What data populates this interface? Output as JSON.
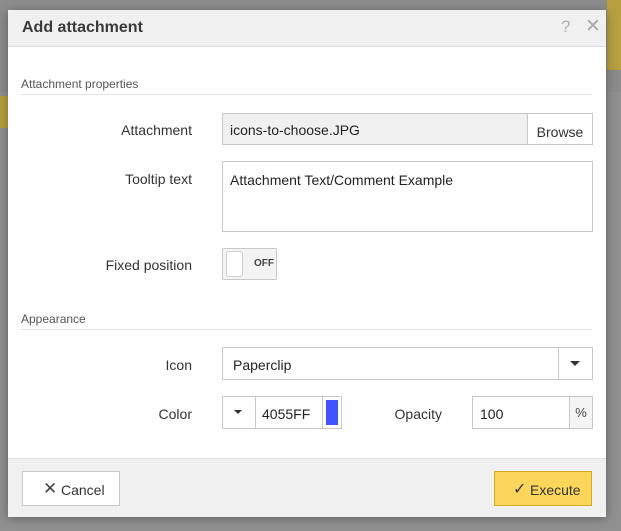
{
  "dialog": {
    "title": "Add attachment",
    "help_icon": "?",
    "close_icon": "✕"
  },
  "sections": {
    "properties": "Attachment properties",
    "appearance": "Appearance"
  },
  "fields": {
    "attachment_label": "Attachment",
    "attachment_value": "icons-to-choose.JPG",
    "browse_label": "Browse",
    "tooltip_label": "Tooltip text",
    "tooltip_value": "Attachment Text/Comment Example",
    "fixed_label": "Fixed position",
    "fixed_state": "OFF",
    "icon_label": "Icon",
    "icon_value": "Paperclip",
    "color_label": "Color",
    "color_value": "4055FF",
    "color_swatch": "#4055FF",
    "opacity_label": "Opacity",
    "opacity_value": "100",
    "opacity_unit": "%"
  },
  "footer": {
    "cancel_label": "Cancel",
    "cancel_icon": "✕",
    "execute_label": "Execute",
    "execute_icon": "✓"
  },
  "colors": {
    "execute_bg": "#fbd65a",
    "swatch": "#4055FF"
  }
}
